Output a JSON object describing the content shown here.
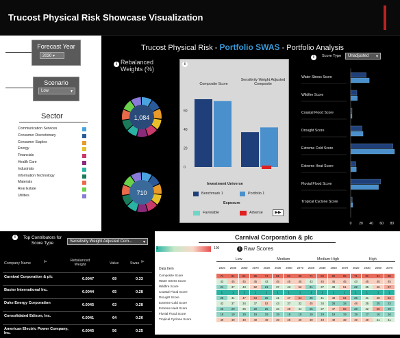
{
  "app_title": "Trucost Physical Risk Showcase Visualization",
  "forecast": {
    "label": "Forecast Year",
    "value": "2030"
  },
  "scenario": {
    "label": "Scenario",
    "value": "Low"
  },
  "sector": {
    "title": "Sector",
    "items": [
      {
        "label": "Communication Services",
        "color": "#4aa3df"
      },
      {
        "label": "Consumer Discretionary",
        "color": "#2b5a9a"
      },
      {
        "label": "Consumer Staples",
        "color": "#e89b2a"
      },
      {
        "label": "Energy",
        "color": "#e8c12a"
      },
      {
        "label": "Financials",
        "color": "#c73a6a"
      },
      {
        "label": "Health Care",
        "color": "#8a2a7a"
      },
      {
        "label": "Industrials",
        "color": "#2ab3a3"
      },
      {
        "label": "Information Technology",
        "color": "#1a7a5a"
      },
      {
        "label": "Materials",
        "color": "#e86a4a"
      },
      {
        "label": "Real Estate",
        "color": "#6ad14a"
      },
      {
        "label": "Utilities",
        "color": "#8a7ad9"
      }
    ]
  },
  "main_title": {
    "prefix": "Trucost Physical Risk -",
    "highlight": "Portfolio SWAS",
    "suffix": "- Portfolio Analysis"
  },
  "weights": {
    "title": "Rebalanced Weights (%)",
    "donut1": "1,084",
    "donut2": "710"
  },
  "composite_chart": {
    "col1": "Composite Score",
    "col2": "Sensitivity Weight Adjusted Composite",
    "legend_title": "Investment Universe",
    "benchmark": "Benchmark 1",
    "portfolio": "Portfolio 1",
    "exposure_title": "Exposure",
    "favorable": "Favorable",
    "adverse": "Adverse"
  },
  "chart_data": [
    {
      "type": "bar",
      "categories": [
        "Composite Score",
        "Sensitivity Weight Adjusted Composite"
      ],
      "series": [
        {
          "name": "Benchmark 1",
          "values": [
            72,
            37
          ]
        },
        {
          "name": "Portfolio 1",
          "values": [
            70,
            42
          ]
        }
      ],
      "ylim": [
        0,
        80
      ],
      "yticks": [
        "0",
        "20",
        "40",
        "60"
      ]
    },
    {
      "type": "bar",
      "orientation": "horizontal",
      "categories": [
        "Water Stress Score",
        "Wildfire Score",
        "Coastal Flood Score",
        "Drought Score",
        "Extreme Cold Score",
        "Extreme Heat Score",
        "Fluvial Flood Score",
        "Tropical Cyclone Score"
      ],
      "series": [
        {
          "name": "Benchmark 1",
          "values": [
            30,
            12,
            2,
            22,
            82,
            10,
            58,
            3
          ]
        },
        {
          "name": "Portfolio 1",
          "values": [
            36,
            13,
            2,
            24,
            85,
            11,
            54,
            4
          ]
        }
      ],
      "xlim": [
        0,
        85
      ],
      "xticks": [
        "0",
        "20",
        "40",
        "60",
        "80"
      ]
    }
  ],
  "score_type": {
    "label": "Score Type",
    "value": "Unadjusted"
  },
  "contributors": {
    "title": "Top Contributors for Score Type",
    "dropdown": "Sensitivity Weight Adjusted Com...",
    "headers": [
      "Company Name",
      "Rebalanced Weight",
      "Value",
      "Swas"
    ],
    "rows": [
      {
        "name": "Carnival Corporation & plc",
        "weight": "0.0047",
        "value": "69",
        "swas": "0.33"
      },
      {
        "name": "Baxter International Inc.",
        "weight": "0.0044",
        "value": "65",
        "swas": "0.28"
      },
      {
        "name": "Duke Energy Corporation",
        "weight": "0.0045",
        "value": "63",
        "swas": "0.28"
      },
      {
        "name": "Consolidated Edison, Inc.",
        "weight": "0.0041",
        "value": "64",
        "swas": "0.26"
      },
      {
        "name": "American Electric Power Company, Inc.",
        "weight": "0.0045",
        "value": "56",
        "swas": "0.25"
      }
    ]
  },
  "company": {
    "title": "Carnival Corporation & plc",
    "scale_min": "1",
    "scale_max": "100",
    "raw_title": "Raw Scores"
  },
  "heatmap": {
    "groups": [
      "Low",
      "Medium",
      "Medium-High",
      "High"
    ],
    "years": [
      "2020",
      "2030",
      "2050",
      "2070",
      "2090"
    ],
    "item_header": "Data Item",
    "rows": [
      {
        "label": "Composite Score",
        "values": [
          "71",
          "81",
          "81",
          "85",
          "71",
          "81",
          "81",
          "85",
          "71",
          "82",
          "82",
          "85",
          "71",
          "81",
          "81",
          "85"
        ]
      },
      {
        "label": "Water Stress Score",
        "values": [
          "43",
          "45",
          "45",
          "45",
          "43",
          "45",
          "45",
          "45",
          "43",
          "45",
          "45",
          "45",
          "43",
          "45",
          "45",
          "45"
        ]
      },
      {
        "label": "Wildfire Score",
        "values": [
          "21",
          "37",
          "43",
          "52",
          "21",
          "37",
          "43",
          "52",
          "21",
          "37",
          "39",
          "51",
          "22",
          "35",
          "46",
          "57"
        ]
      },
      {
        "label": "Coastal Flood Score",
        "values": [
          "1",
          "1",
          "1",
          "1",
          "1",
          "1",
          "1",
          "1",
          "1",
          "1",
          "1",
          "1",
          "1",
          "1",
          "1",
          "1"
        ]
      },
      {
        "label": "Drought Score",
        "values": [
          "25",
          "41",
          "47",
          "64",
          "25",
          "41",
          "47",
          "64",
          "25",
          "41",
          "48",
          "64",
          "25",
          "41",
          "48",
          "64"
        ]
      },
      {
        "label": "Extreme Cold Score",
        "values": [
          "42",
          "37",
          "34",
          "37",
          "52",
          "43",
          "37",
          "32",
          "45",
          "34",
          "26",
          "18",
          "48",
          "35",
          "25",
          "23"
        ]
      },
      {
        "label": "Extreme Heat Score",
        "values": [
          "25",
          "29",
          "36",
          "29",
          "25",
          "34",
          "48",
          "44",
          "25",
          "37",
          "47",
          "56",
          "28",
          "42",
          "56",
          "29"
        ]
      },
      {
        "label": "Fluvial Flood Score",
        "values": [
          "18",
          "19",
          "19",
          "19",
          "19",
          "19",
          "19",
          "19",
          "19",
          "19",
          "19",
          "19",
          "19",
          "17",
          "16",
          "16"
        ]
      },
      {
        "label": "Tropical Cyclone Score",
        "values": [
          "49",
          "49",
          "49",
          "49",
          "49",
          "49",
          "49",
          "49",
          "49",
          "49",
          "49",
          "49",
          "49",
          "49",
          "41",
          "41"
        ]
      }
    ]
  }
}
